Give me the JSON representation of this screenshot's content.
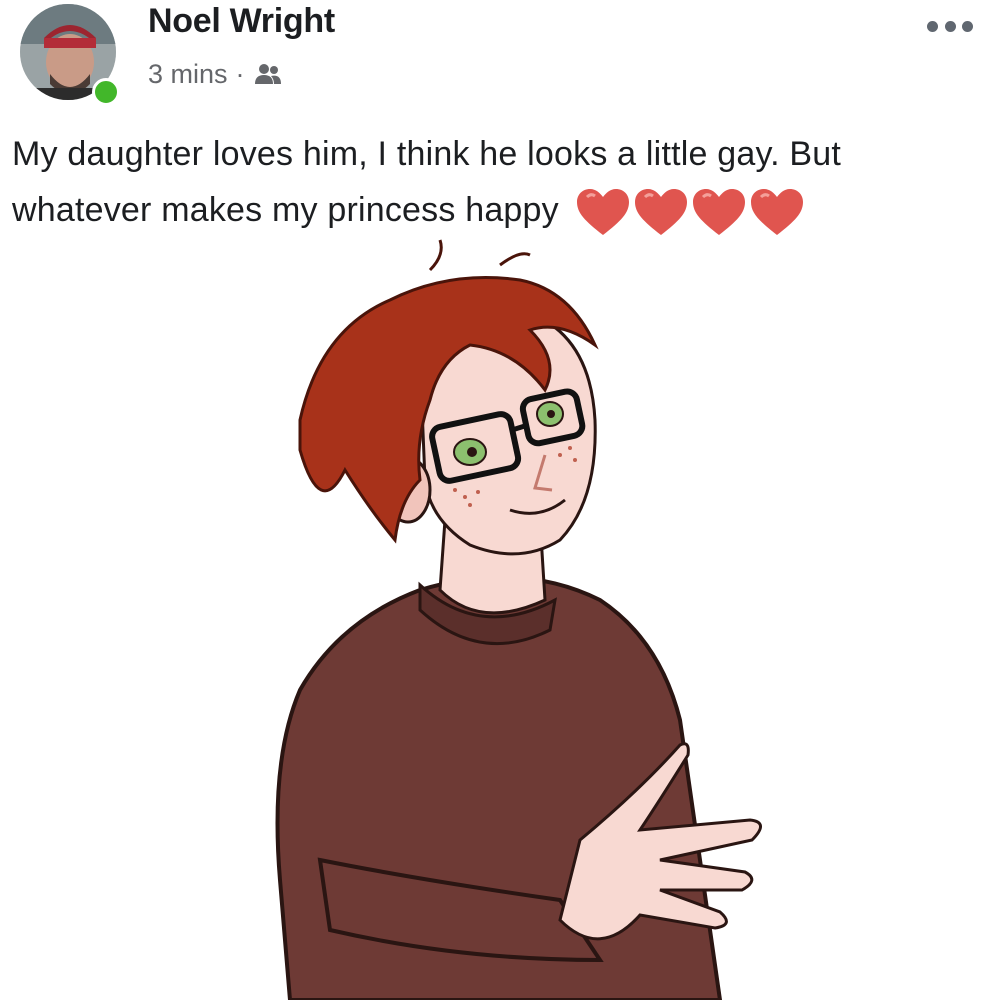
{
  "post": {
    "author": "Noel Wright",
    "timestamp": "3 mins",
    "separator": "·",
    "audience_icon": "friends-icon",
    "text": "My daughter loves him, I think he looks a little gay. But whatever makes my princess happy",
    "emoji": [
      "red-heart",
      "red-heart",
      "red-heart",
      "red-heart"
    ],
    "more_icon": "more-dots-icon"
  },
  "image": {
    "subject": "anime-style boy with red hair, glasses and brown sweater"
  },
  "colors": {
    "online": "#42b72a",
    "heart": "#e0554f",
    "hair": "#a8321a",
    "sweater": "#6e3a35",
    "skin": "#f8d9d2",
    "eyes": "#8cc06e"
  }
}
